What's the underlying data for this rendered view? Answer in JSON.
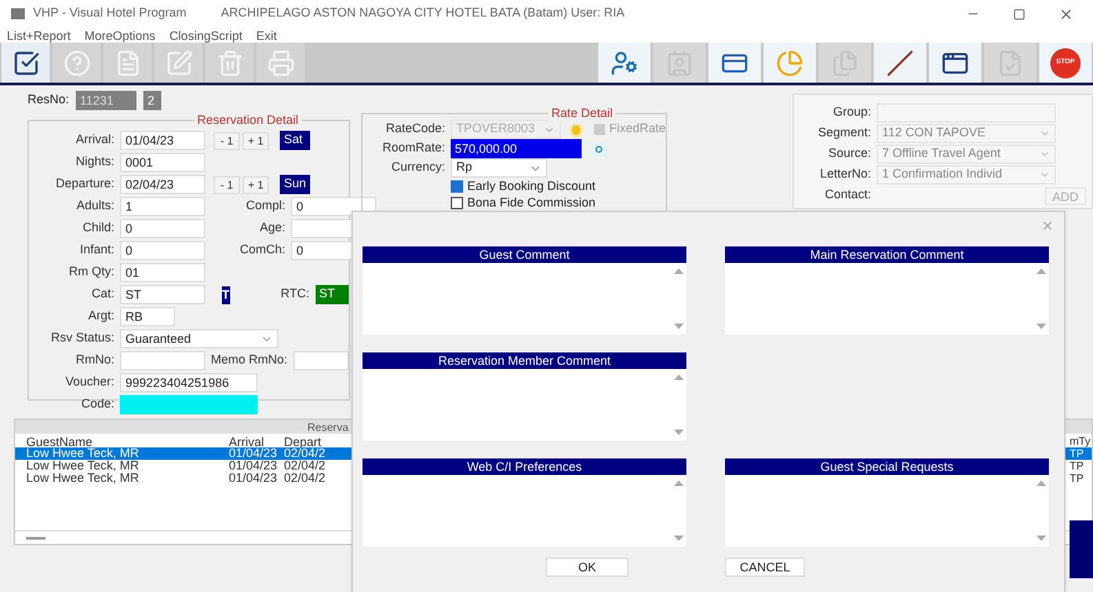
{
  "window": {
    "title": "VHP - Visual Hotel Program",
    "subtitle": "ARCHIPELAGO ASTON NAGOYA CITY HOTEL BATA (Batam) User: RIA"
  },
  "menu": [
    "List+Report",
    "MoreOptions",
    "ClosingScript",
    "Exit"
  ],
  "toolbar": {
    "left": [
      {
        "disabled": false
      },
      {
        "disabled": true
      },
      {
        "disabled": true
      },
      {
        "disabled": true
      },
      {
        "disabled": true
      },
      {
        "disabled": true
      }
    ],
    "right": [
      {
        "disabled": false
      },
      {
        "disabled": true
      },
      {
        "disabled": false
      },
      {
        "disabled": false
      },
      {
        "disabled": true
      },
      {
        "disabled": false
      },
      {
        "disabled": false
      },
      {
        "disabled": true
      },
      {
        "disabled": false
      }
    ],
    "stop_label": "STOP"
  },
  "reservation": {
    "res_no_label": "ResNo:",
    "res_no": "11231",
    "res_seq": "2",
    "title": "Reservation Detail",
    "rows": [
      [
        {
          "kind": "field",
          "label": "Arrival:",
          "value": "01/04/23"
        },
        {
          "kind": "stepper",
          "minus": "- 1",
          "plus": "+ 1"
        },
        {
          "kind": "day",
          "value": "Sat"
        }
      ],
      [
        {
          "kind": "field",
          "label": "Nights:",
          "value": "0001"
        }
      ],
      [
        {
          "kind": "field",
          "label": "Departure:",
          "value": "02/04/23"
        },
        {
          "kind": "stepper",
          "minus": "- 1",
          "plus": "+ 1"
        },
        {
          "kind": "day",
          "value": "Sun"
        }
      ],
      [
        {
          "kind": "field",
          "label": "Adults:",
          "value": "1"
        },
        {
          "kind": "field",
          "label": "Compl:",
          "value": "0"
        }
      ],
      [
        {
          "kind": "field",
          "label": "Child:",
          "value": "0"
        },
        {
          "kind": "field",
          "label": "Age:"
        }
      ],
      [
        {
          "kind": "field",
          "label": "Infant:",
          "value": "0"
        },
        {
          "kind": "field",
          "label": "ComCh:",
          "value": "0"
        }
      ],
      [
        {
          "kind": "field",
          "label": "Rm Qty:",
          "value": "01"
        }
      ],
      [
        {
          "kind": "field",
          "label": "Cat:",
          "value": "ST"
        },
        {
          "kind": "flag",
          "value": "T"
        },
        {
          "kind": "green",
          "label": "RTC:",
          "value": "ST"
        }
      ],
      [
        {
          "kind": "short",
          "label": "Argt:",
          "value": "RB"
        }
      ],
      [
        {
          "kind": "select",
          "label": "Rsv Status:",
          "value": "Guaranteed"
        }
      ],
      [
        {
          "kind": "field",
          "label": "RmNo:"
        },
        {
          "kind": "short",
          "label": "Memo RmNo:"
        }
      ],
      [
        {
          "kind": "wide",
          "label": "Voucher:",
          "value": "999223404251986"
        }
      ],
      [
        {
          "kind": "cyan",
          "label": "Code:"
        }
      ]
    ]
  },
  "rate": {
    "title": "Rate Detail",
    "rate_code_label": "RateCode:",
    "rate_code": "TPOVER8003",
    "fixed_rate": {
      "label": "FixedRate",
      "checked": false
    },
    "room_rate_label": "RoomRate:",
    "room_rate": "570,000.00",
    "currency_label": "Currency:",
    "currency": "Rp",
    "options": [
      {
        "label": "Early Booking Discount",
        "checked": true
      },
      {
        "label": "Bona Fide Commission",
        "checked": false
      }
    ]
  },
  "booking": {
    "rows": [
      {
        "label": "Group:"
      },
      {
        "label": "Segment:",
        "value": "112 CON TAPOVE"
      },
      {
        "label": "Source:",
        "value": "7 Offline Travel Agent"
      },
      {
        "label": "LetterNo:",
        "value": "1 Confirmation Individ"
      }
    ],
    "contact_label": "Contact:",
    "add_button": "ADD"
  },
  "table": {
    "group_title": "Reserva",
    "columns": [
      "GuestName",
      "Arrival",
      "Depart",
      "mTy"
    ],
    "rows": [
      {
        "selected": true,
        "cells": [
          "Low Hwee Teck,  MR",
          "01/04/23",
          "02/04/2",
          "TP"
        ]
      },
      {
        "selected": false,
        "cells": [
          "Low Hwee Teck,  MR",
          "01/04/23",
          "02/04/2",
          "TP"
        ]
      },
      {
        "selected": false,
        "cells": [
          "Low Hwee Teck,  MR",
          "01/04/23",
          "02/04/2",
          "TP"
        ]
      }
    ]
  },
  "dialog": {
    "rows": [
      [
        {
          "title": "Guest Comment"
        },
        {
          "title": "Main Reservation Comment"
        }
      ],
      [
        {
          "title": "Reservation Member Comment"
        }
      ],
      [
        {
          "title": "Web C/I Preferences"
        },
        {
          "title": "Guest Special Requests"
        }
      ]
    ],
    "ok": "OK",
    "cancel": "CANCEL"
  }
}
